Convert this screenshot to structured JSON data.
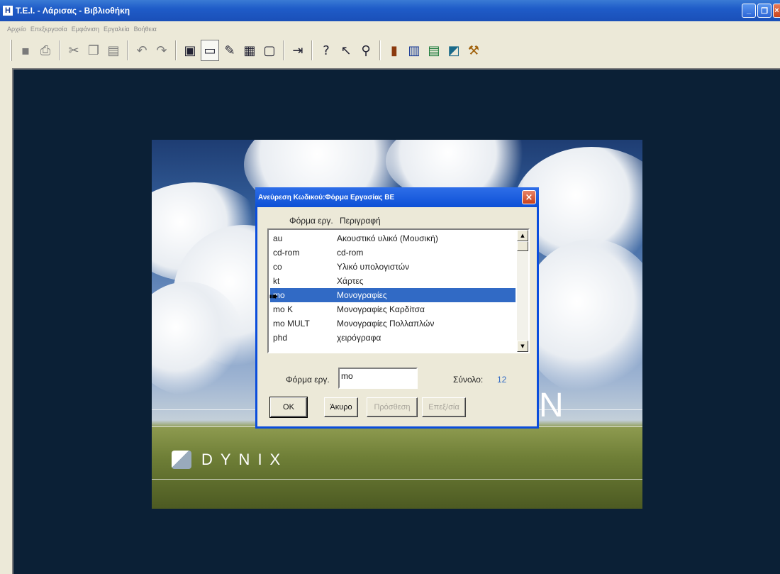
{
  "window": {
    "title": "T.E.I. - Λάρισας - Βιβλιοθήκη",
    "app_icon": "Η",
    "minimize": "_",
    "restore": "❐",
    "close": "×"
  },
  "menu": {
    "items": [
      "Αρχείο",
      "Επεξεργασία",
      "Εμφάνιση",
      "Εργαλεία",
      "Βοήθεια"
    ]
  },
  "toolbar": {
    "icons": [
      "save-icon",
      "print-icon",
      "cut-icon",
      "copy-icon",
      "paste-icon",
      "undo-icon",
      "redo-icon",
      "cascade-icon",
      "window-icon",
      "tools-icon",
      "grid-icon",
      "form-icon",
      "import-icon",
      "help-icon",
      "context-help-icon",
      "search-icon",
      "door-icon",
      "book-search-icon",
      "return-books-icon",
      "note-icon",
      "gavel-icon"
    ]
  },
  "splash": {
    "brand": "DYNIX",
    "partial_text": "N"
  },
  "dialog": {
    "title": "Ανεύρεση Κωδικού:Φόρμα Εργασίας ΒΕ",
    "col_code": "Φόρμα εργ.",
    "col_desc": "Περιγραφή",
    "rows": [
      {
        "code": "au",
        "desc": "Ακουστικό υλικό (Μουσική)"
      },
      {
        "code": "cd-rom",
        "desc": "cd-rom"
      },
      {
        "code": "co",
        "desc": "Υλικό υπολογιστών"
      },
      {
        "code": "kt",
        "desc": "Χάρτες"
      },
      {
        "code": "mo",
        "desc": "Μονογραφίες"
      },
      {
        "code": "mo K",
        "desc": "Μονογραφίες Καρδίτσα"
      },
      {
        "code": "mo MULT",
        "desc": "Μονογραφίες Πολλαπλών"
      },
      {
        "code": "phd",
        "desc": "χειρόγραφα"
      }
    ],
    "selected_index": 4,
    "field_label": "Φόρμα εργ.",
    "field_value": "mo",
    "total_label": "Σύνολο:",
    "total_value": "12",
    "buttons": {
      "ok": "OK",
      "cancel": "Άκυρο",
      "add": "Πρόσθεση",
      "edit": "Επεξ/σία"
    }
  }
}
